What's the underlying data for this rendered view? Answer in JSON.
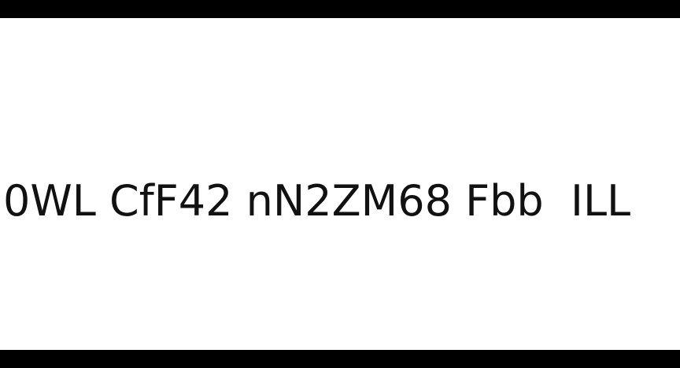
{
  "text_line": "0WL CfF42 nN2ZM68 Fbb  ILL",
  "colors": {
    "background": "#ffffff",
    "bars": "#000000",
    "text": "#111111"
  }
}
